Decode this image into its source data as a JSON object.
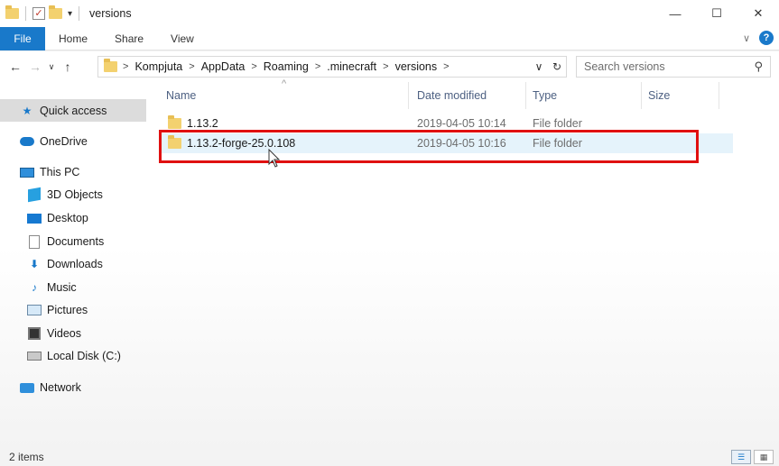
{
  "titlebar": {
    "title": "versions",
    "qat_arrow": "▾",
    "minimize": "—",
    "maximize": "☐",
    "close": "✕"
  },
  "ribbon": {
    "tabs": [
      "File",
      "Home",
      "Share",
      "View"
    ],
    "expand": "∨",
    "help": "?"
  },
  "nav": {
    "back": "←",
    "forward": "→",
    "recent": "∨",
    "up": "↑",
    "breadcrumb": [
      "Kompjuta",
      "AppData",
      "Roaming",
      ".minecraft",
      "versions"
    ],
    "addr_dropdown": "∨",
    "refresh": "↻",
    "search_placeholder": "Search versions"
  },
  "sidebar": {
    "items": [
      {
        "label": "Quick access",
        "icon": "star-icon",
        "selected": true
      },
      {
        "label": "OneDrive",
        "icon": "cloud-icon"
      },
      {
        "label": "This PC",
        "icon": "computer-icon"
      },
      {
        "label": "3D Objects",
        "icon": "cube-icon"
      },
      {
        "label": "Desktop",
        "icon": "desktop-icon"
      },
      {
        "label": "Documents",
        "icon": "document-icon"
      },
      {
        "label": "Downloads",
        "icon": "download-icon"
      },
      {
        "label": "Music",
        "icon": "music-icon"
      },
      {
        "label": "Pictures",
        "icon": "pictures-icon"
      },
      {
        "label": "Videos",
        "icon": "videos-icon"
      },
      {
        "label": "Local Disk (C:)",
        "icon": "disk-icon"
      },
      {
        "label": "Network",
        "icon": "network-icon"
      }
    ]
  },
  "filelist": {
    "columns": [
      "Name",
      "Date modified",
      "Type",
      "Size"
    ],
    "sort_indicator": "^",
    "rows": [
      {
        "name": "1.13.2",
        "date": "2019-04-05 10:14",
        "type": "File folder",
        "size": ""
      },
      {
        "name": "1.13.2-forge-25.0.108",
        "date": "2019-04-05 10:16",
        "type": "File folder",
        "size": "",
        "hovered": true
      }
    ],
    "highlight_color": "#e01010"
  },
  "status": {
    "item_count": "2 items"
  },
  "colors": {
    "accent": "#1979ca",
    "folder": "#f3d16f",
    "hover_row": "#e5f3fb"
  }
}
